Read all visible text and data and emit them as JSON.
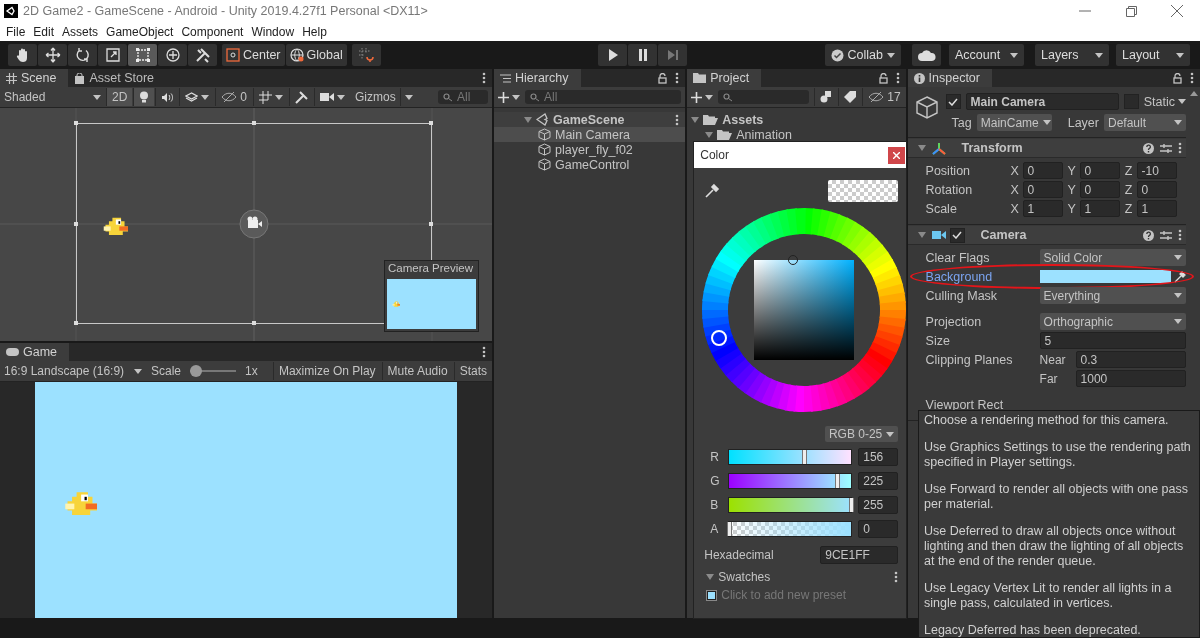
{
  "window": {
    "title": "2D Game2 - GameScene - Android - Unity 2019.4.27f1 Personal <DX11>"
  },
  "menu": [
    "File",
    "Edit",
    "Assets",
    "GameObject",
    "Component",
    "Window",
    "Help"
  ],
  "toolbar": {
    "tools": [
      {
        "kind": "hand",
        "selected": false
      },
      {
        "kind": "move",
        "selected": false
      },
      {
        "kind": "rotate",
        "selected": false
      },
      {
        "kind": "scale",
        "selected": false
      },
      {
        "kind": "rect",
        "selected": true
      },
      {
        "kind": "transform",
        "selected": false
      },
      {
        "kind": "custom",
        "selected": false
      }
    ],
    "pivot": "Center",
    "space": "Global",
    "collab": "Collab",
    "account": "Account",
    "layers": "Layers",
    "layout": "Layout"
  },
  "scene": {
    "tabs": [
      {
        "label": "Scene",
        "kind": "scene",
        "selected": true
      },
      {
        "label": "Asset Store",
        "kind": "store",
        "selected": false
      }
    ],
    "shading": "Shaded",
    "mode_2d": {
      "label": "2D",
      "on": true
    },
    "hidden_count": "0",
    "gizmos": "Gizmos",
    "search": {
      "placeholder": "All"
    },
    "camera_preview": "Camera Preview"
  },
  "game": {
    "tab": "Game",
    "aspect": "16:9 Landscape (16:9)",
    "scale_label": "Scale",
    "scale": {
      "level": 0
    },
    "scale_value": "1x",
    "buttons": [
      {
        "label": "Maximize On Play",
        "on": false
      },
      {
        "label": "Mute Audio",
        "on": false
      },
      {
        "label": "Stats",
        "on": false
      }
    ]
  },
  "hierarchy": {
    "tab": "Hierarchy",
    "search": {
      "placeholder": "All"
    },
    "tree": [
      {
        "label": "GameScene",
        "kind": "scene",
        "expanded": true,
        "selected": false,
        "children": [
          {
            "label": "Main Camera",
            "kind": "object",
            "selected": true
          },
          {
            "label": "player_fly_f02",
            "kind": "object",
            "selected": false
          },
          {
            "label": "GameControl",
            "kind": "object",
            "selected": false
          }
        ]
      }
    ]
  },
  "project": {
    "tab": "Project",
    "hidden_count": "17",
    "tree": [
      {
        "label": "Assets",
        "expanded": true,
        "children": [
          {
            "label": "Animation",
            "expanded": true
          }
        ]
      }
    ]
  },
  "color_picker": {
    "title": "Color",
    "mode": "RGB 0-25",
    "channels": [
      {
        "name": "R",
        "value": "156",
        "level": 0.61
      },
      {
        "name": "G",
        "value": "225",
        "level": 0.88
      },
      {
        "name": "B",
        "value": "255",
        "level": 1
      },
      {
        "name": "A",
        "value": "0",
        "level": 0
      }
    ],
    "hex_label": "Hexadecimal",
    "hex": "9CE1FF",
    "swatches": {
      "label": "Swatches",
      "expanded": true,
      "hint": "Click to add new preset"
    }
  },
  "inspector": {
    "tab": "Inspector",
    "object": {
      "active": true,
      "name": "Main Camera",
      "static": false,
      "static_label": "Static",
      "tag_label": "Tag",
      "tag": "MainCame",
      "layer_label": "Layer",
      "layer": "Default"
    },
    "components": [
      {
        "name": "Transform",
        "kind": "transform",
        "expanded": true,
        "rows": [
          {
            "label": "Position",
            "values": [
              {
                "axis": "X",
                "value": "0"
              },
              {
                "axis": "Y",
                "value": "0"
              },
              {
                "axis": "Z",
                "value": "-10"
              }
            ]
          },
          {
            "label": "Rotation",
            "values": [
              {
                "axis": "X",
                "value": "0"
              },
              {
                "axis": "Y",
                "value": "0"
              },
              {
                "axis": "Z",
                "value": "0"
              }
            ]
          },
          {
            "label": "Scale",
            "values": [
              {
                "axis": "X",
                "value": "1"
              },
              {
                "axis": "Y",
                "value": "1"
              },
              {
                "axis": "Z",
                "value": "1"
              }
            ]
          }
        ]
      },
      {
        "name": "Camera",
        "kind": "camera",
        "enabled": true,
        "expanded": true,
        "rows": [
          {
            "kind": "dropdown",
            "label": "Clear Flags",
            "value": "Solid Color"
          },
          {
            "kind": "color",
            "label": "Background",
            "color": "#9ce1ff",
            "highlighted": true
          },
          {
            "kind": "dropdown",
            "label": "Culling Mask",
            "value": "Everything"
          },
          {
            "kind": "dropdown",
            "label": "Projection",
            "value": "Orthographic"
          },
          {
            "kind": "text",
            "label": "Size",
            "value": "5"
          },
          {
            "kind": "pair",
            "label": "Clipping Planes",
            "sub_label": "Near",
            "value": "0.3"
          },
          {
            "kind": "pair",
            "sub_label": "Far",
            "value": "1000"
          },
          {
            "kind": "heading",
            "label": "Viewport Rect"
          }
        ]
      }
    ]
  },
  "tooltip": {
    "paragraphs": [
      "Choose a rendering method for this camera.",
      "Use Graphics Settings to use the rendering path specified in Player settings.",
      "Use Forward to render all objects with one pass per material.",
      "Use Deferred to draw all objects once without lighting and then draw the lighting of all objects at the end of the render queue.",
      "Use Legacy Vertex Lit to render all lights in a single pass, calculated in vertices.",
      "Legacy Deferred has been deprecated."
    ]
  }
}
